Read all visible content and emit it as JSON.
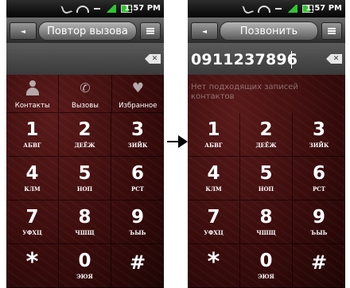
{
  "status": {
    "time": "1:57 PM"
  },
  "left_screen": {
    "header": {
      "title": "Повтор вызова"
    },
    "tabs": [
      {
        "label": "Контакты",
        "icon": "person-icon"
      },
      {
        "label": "Вызовы",
        "icon": "phone-handset-icon"
      },
      {
        "label": "Избранное",
        "icon": "heart-icon"
      }
    ]
  },
  "right_screen": {
    "header": {
      "title": "Позвонить"
    },
    "number": "0911237896",
    "no_matches": "Нет подходящих записей контактов"
  },
  "keypad": [
    {
      "digit": "1",
      "letters": "АБВГ"
    },
    {
      "digit": "2",
      "letters": "ДЕЁЖ"
    },
    {
      "digit": "3",
      "letters": "ЗИЙК"
    },
    {
      "digit": "4",
      "letters": "КЛМ"
    },
    {
      "digit": "5",
      "letters": "НОП"
    },
    {
      "digit": "6",
      "letters": "РСТ"
    },
    {
      "digit": "7",
      "letters": "УФХЦ"
    },
    {
      "digit": "8",
      "letters": "ЧШЩ"
    },
    {
      "digit": "9",
      "letters": "ЪЫЬ"
    },
    {
      "digit": "*",
      "letters": ""
    },
    {
      "digit": "0",
      "letters": "ЭЮЯ"
    },
    {
      "digit": "#",
      "letters": ""
    }
  ]
}
